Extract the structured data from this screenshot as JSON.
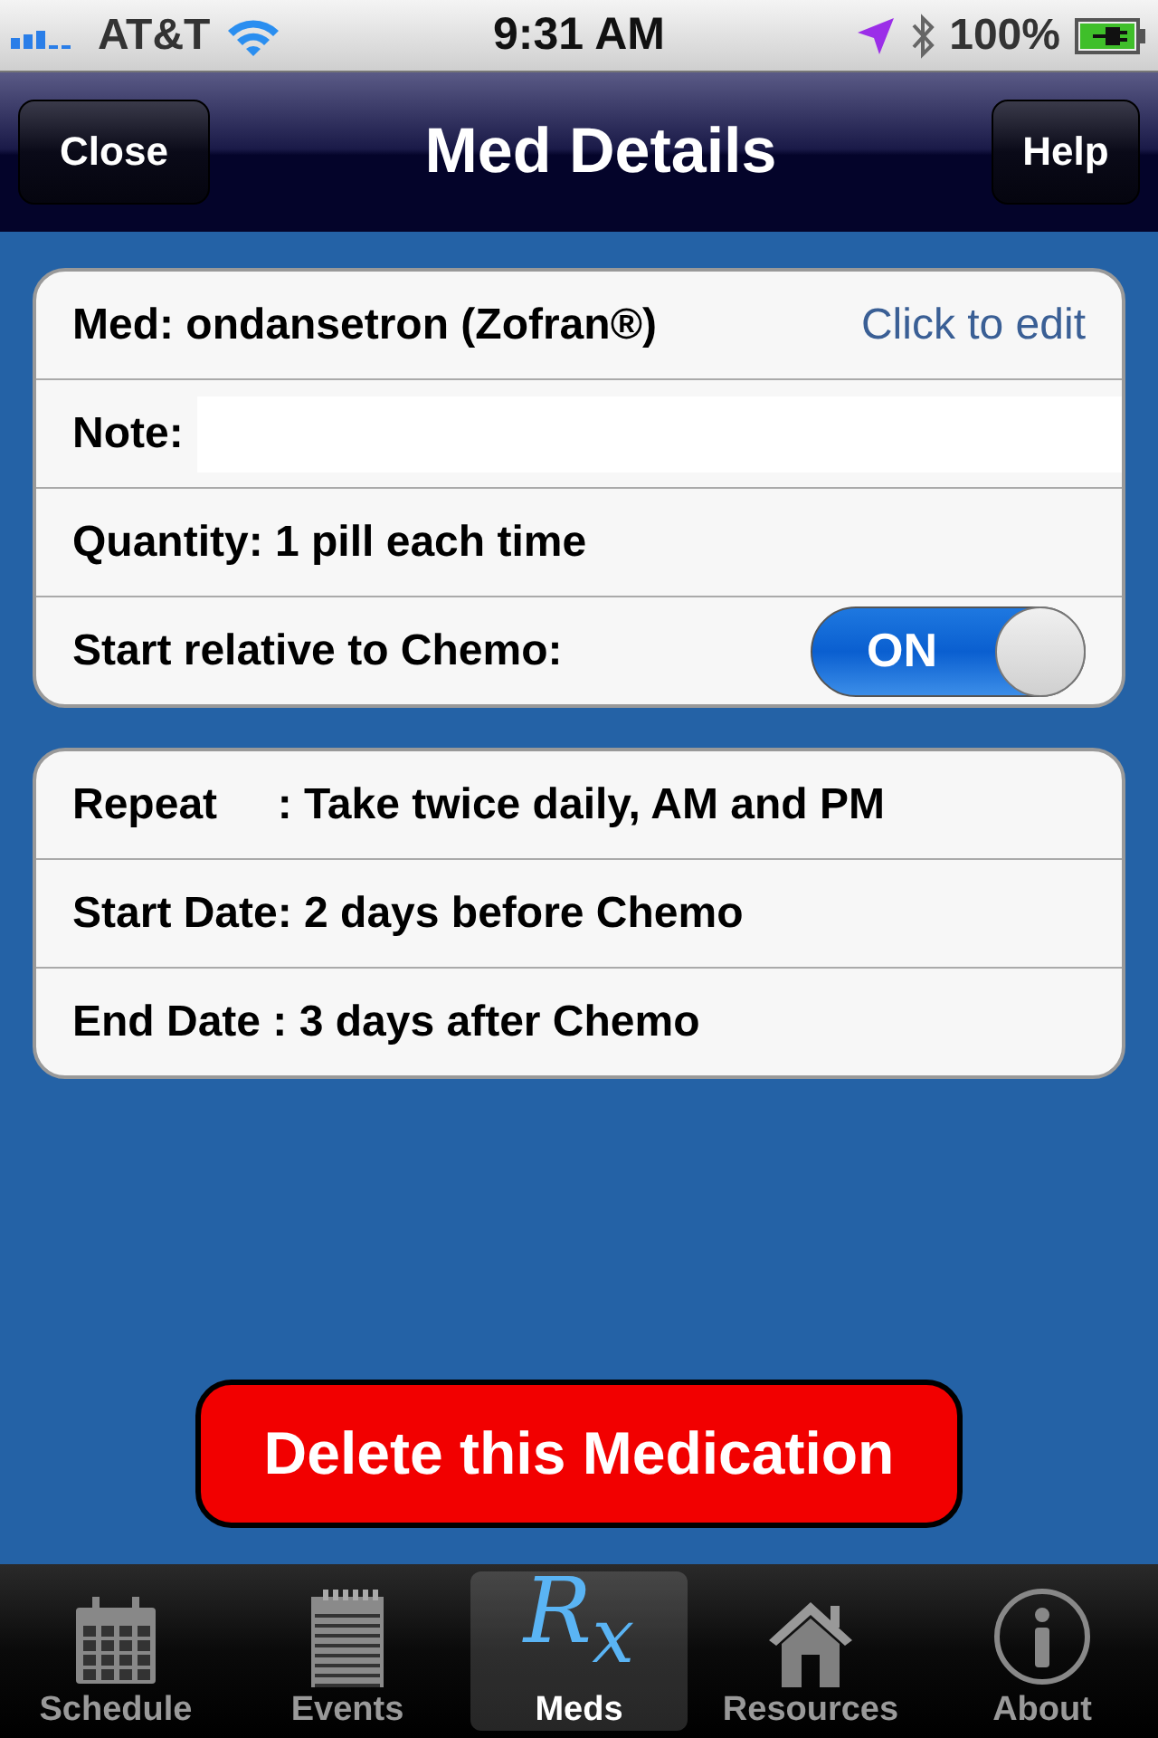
{
  "status_bar": {
    "carrier": "AT&T",
    "time": "9:31 AM",
    "battery": "100%"
  },
  "nav_bar": {
    "left_button": "Close",
    "title": "Med Details",
    "right_button": "Help"
  },
  "details": {
    "med": "Med: ondansetron (Zofran®)",
    "edit_link": "Click to edit",
    "note_label": "Note:",
    "quantity": "Quantity: 1 pill each time",
    "toggle_label": "Start relative to Chemo:",
    "toggle": {
      "on": true,
      "label": "ON"
    }
  },
  "schedule": [
    "Repeat     : Take twice daily, AM and PM",
    "Start Date: 2 days before Chemo",
    "End Date : 3 days after Chemo"
  ],
  "delete_button": "Delete this Medication",
  "tabs": [
    {
      "label": "Schedule",
      "kind": "calendar",
      "selected": false
    },
    {
      "label": "Events",
      "kind": "notepad",
      "selected": false
    },
    {
      "label": "Meds",
      "kind": "rx",
      "glyph": "R$_{x}$",
      "selected": true
    },
    {
      "label": "Resources",
      "kind": "house",
      "selected": false
    },
    {
      "label": "About",
      "kind": "info",
      "selected": false
    }
  ]
}
